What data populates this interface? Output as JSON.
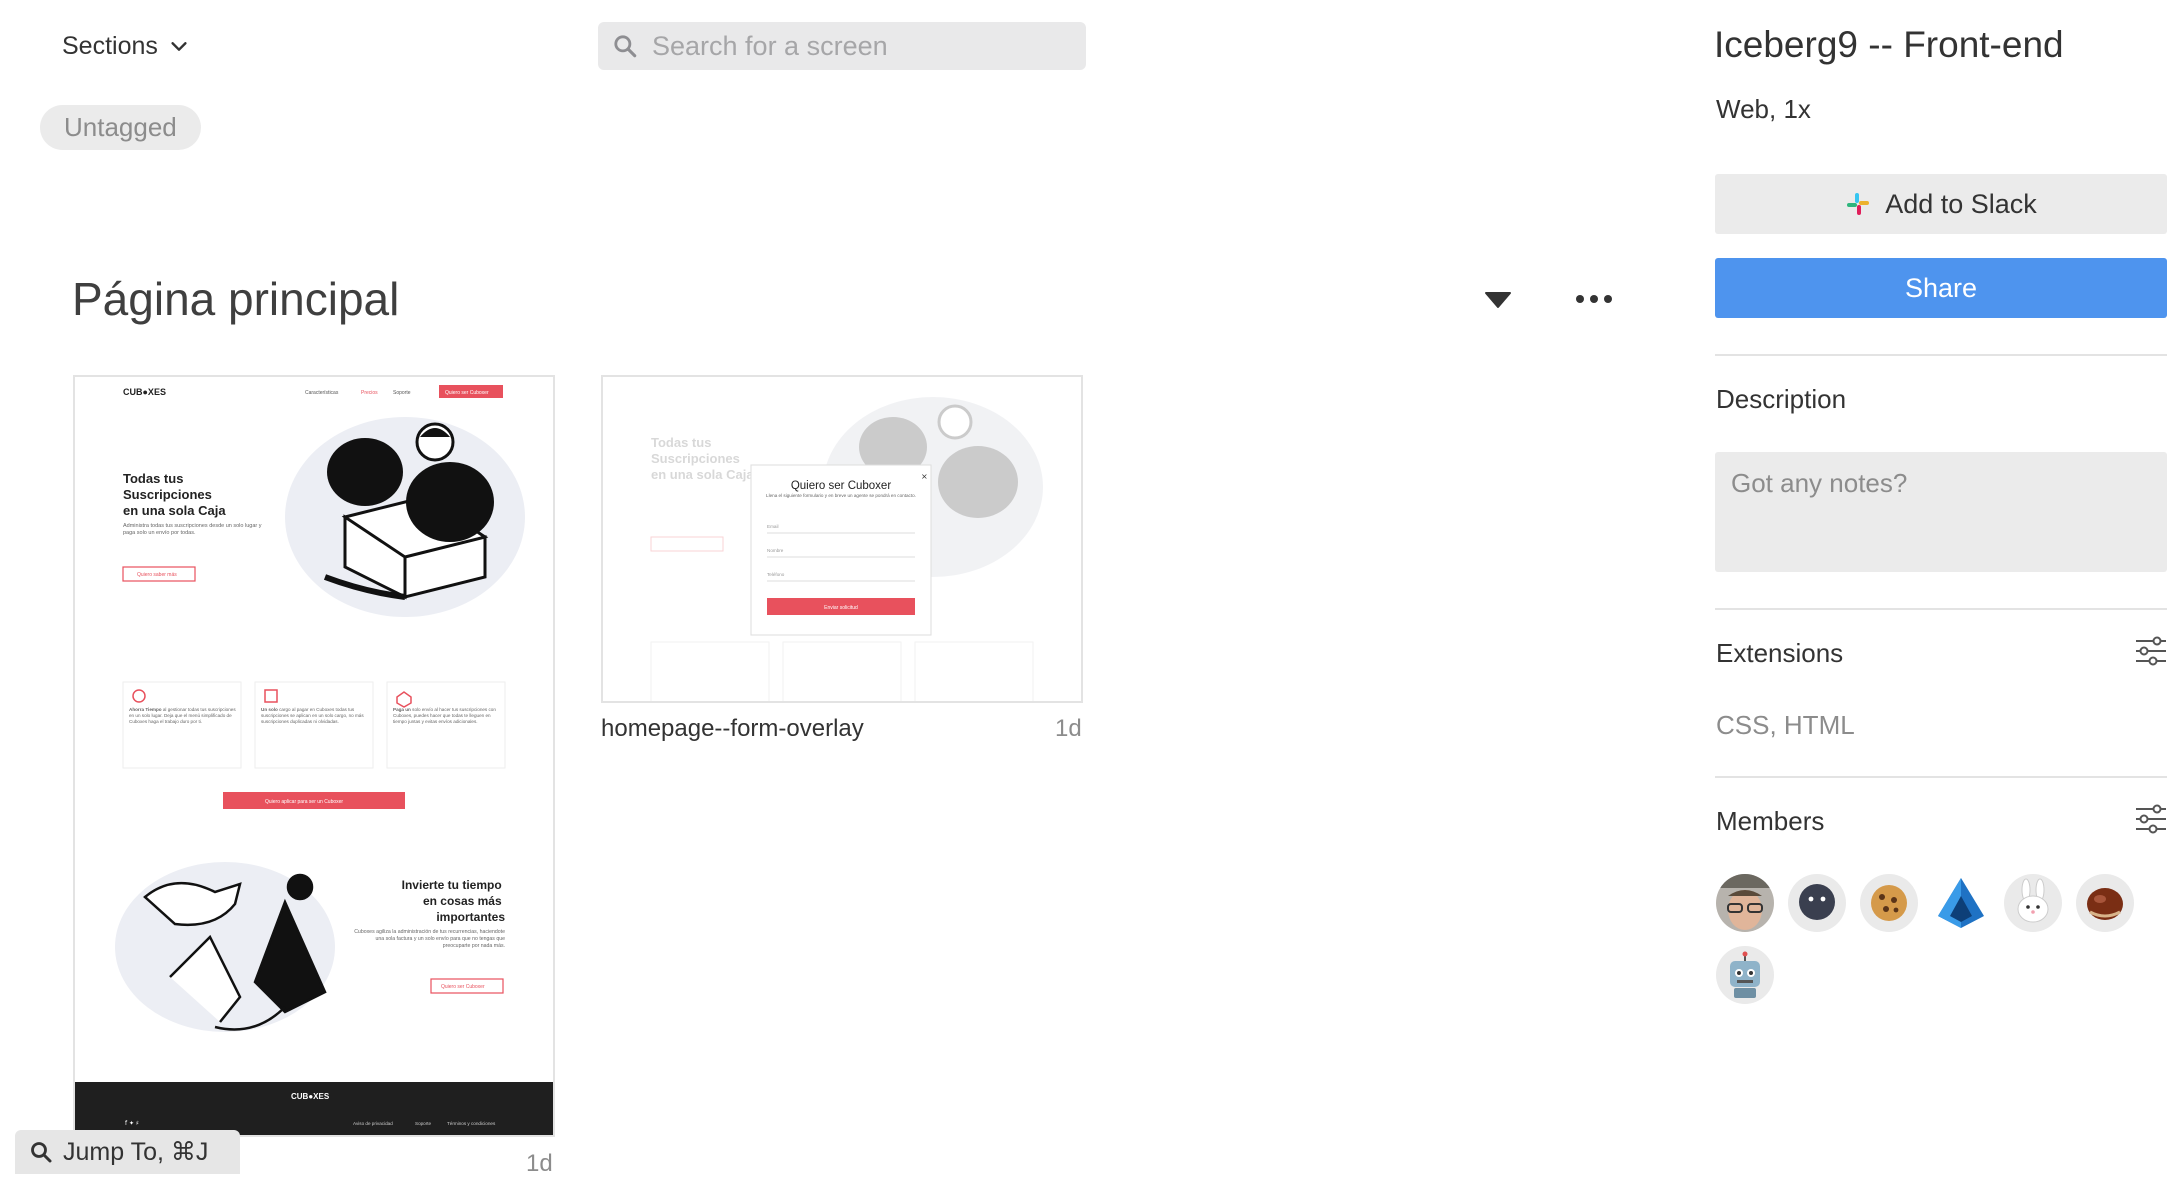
{
  "header": {
    "sections_label": "Sections",
    "search_placeholder": "Search for a screen"
  },
  "tags": {
    "untagged_label": "Untagged"
  },
  "section": {
    "title": "Página principal"
  },
  "screens": [
    {
      "name": "",
      "time": "1d",
      "thumb": {
        "logo": "CUB●XES",
        "nav": [
          "Características",
          "Precios",
          "Soporte"
        ],
        "nav_cta": "Quiero ser Cuboxer",
        "hero_title_lines": [
          "Todas tus",
          "Suscripciones",
          "en una sola Caja"
        ],
        "hero_text": "Administra todas tus suscripciones desde un solo lugar y paga solo un envío por todas.",
        "hero_cta": "Quiero saber más",
        "features": [
          {
            "title": "Ahorra Tiempo",
            "text": "al gestionar todas tus suscripciones en un solo lugar. Deja que el menú simplificado de Cuboxes haga el trabajo duro por ti."
          },
          {
            "title": "Un solo",
            "text": "cargo al pagar en Cuboxes todas tus suscripciones se aplican en un solo cargo, no más suscripciones duplicadas ni olvidadas."
          },
          {
            "title": "Paga un",
            "text": "solo envío al hacer tus suscripciones con Cuboxes, puedes hacer que todas te lleguen en tiempo juntas y evitas envíos adicionales."
          }
        ],
        "features_cta": "Quiero aplicar para ser un Cuboxer",
        "invest_title_lines": [
          "Invierte tu tiempo",
          "en cosas más",
          "importantes"
        ],
        "invest_text": "Cuboxes agiliza la administración de tus recurrencias, haciendote una sola factura y un solo envío para que no tengas que preocuparte por nada más.",
        "invest_cta": "Quiero ser Cuboxer",
        "footer_logo": "CUB●XES",
        "footer_links": [
          "Aviso de privacidad",
          "Soporte",
          "Términos y condiciones"
        ]
      }
    },
    {
      "name": "homepage--form-overlay",
      "time": "1d",
      "thumb": {
        "modal_title": "Quiero ser Cuboxer",
        "modal_text": "Llena el siguiente formulario y en breve un agente se pondrá en contacto.",
        "fields": [
          "Email",
          "Nombre",
          "Teléfono"
        ],
        "submit": "Enviar solicitud"
      }
    }
  ],
  "jump_to": {
    "label": "Jump To, ⌘J"
  },
  "sidebar": {
    "project_title": "Iceberg9 -- Front-end",
    "platform": "Web, 1x",
    "slack_button": "Add to Slack",
    "share_button": "Share",
    "description_label": "Description",
    "notes_placeholder": "Got any notes?",
    "extensions_label": "Extensions",
    "extensions_value": "CSS, HTML",
    "members_label": "Members",
    "members": [
      {
        "icon": "person-with-glasses-avatar"
      },
      {
        "icon": "dark-blob-avatar"
      },
      {
        "icon": "cookie-avatar"
      },
      {
        "icon": "crystal-avatar"
      },
      {
        "icon": "bunny-avatar"
      },
      {
        "icon": "chestnut-avatar"
      },
      {
        "icon": "robot-avatar"
      }
    ]
  },
  "colors": {
    "accent_blue": "#4e94ee",
    "brand_red": "#e8515d",
    "panel_gray": "#ebebeb"
  }
}
